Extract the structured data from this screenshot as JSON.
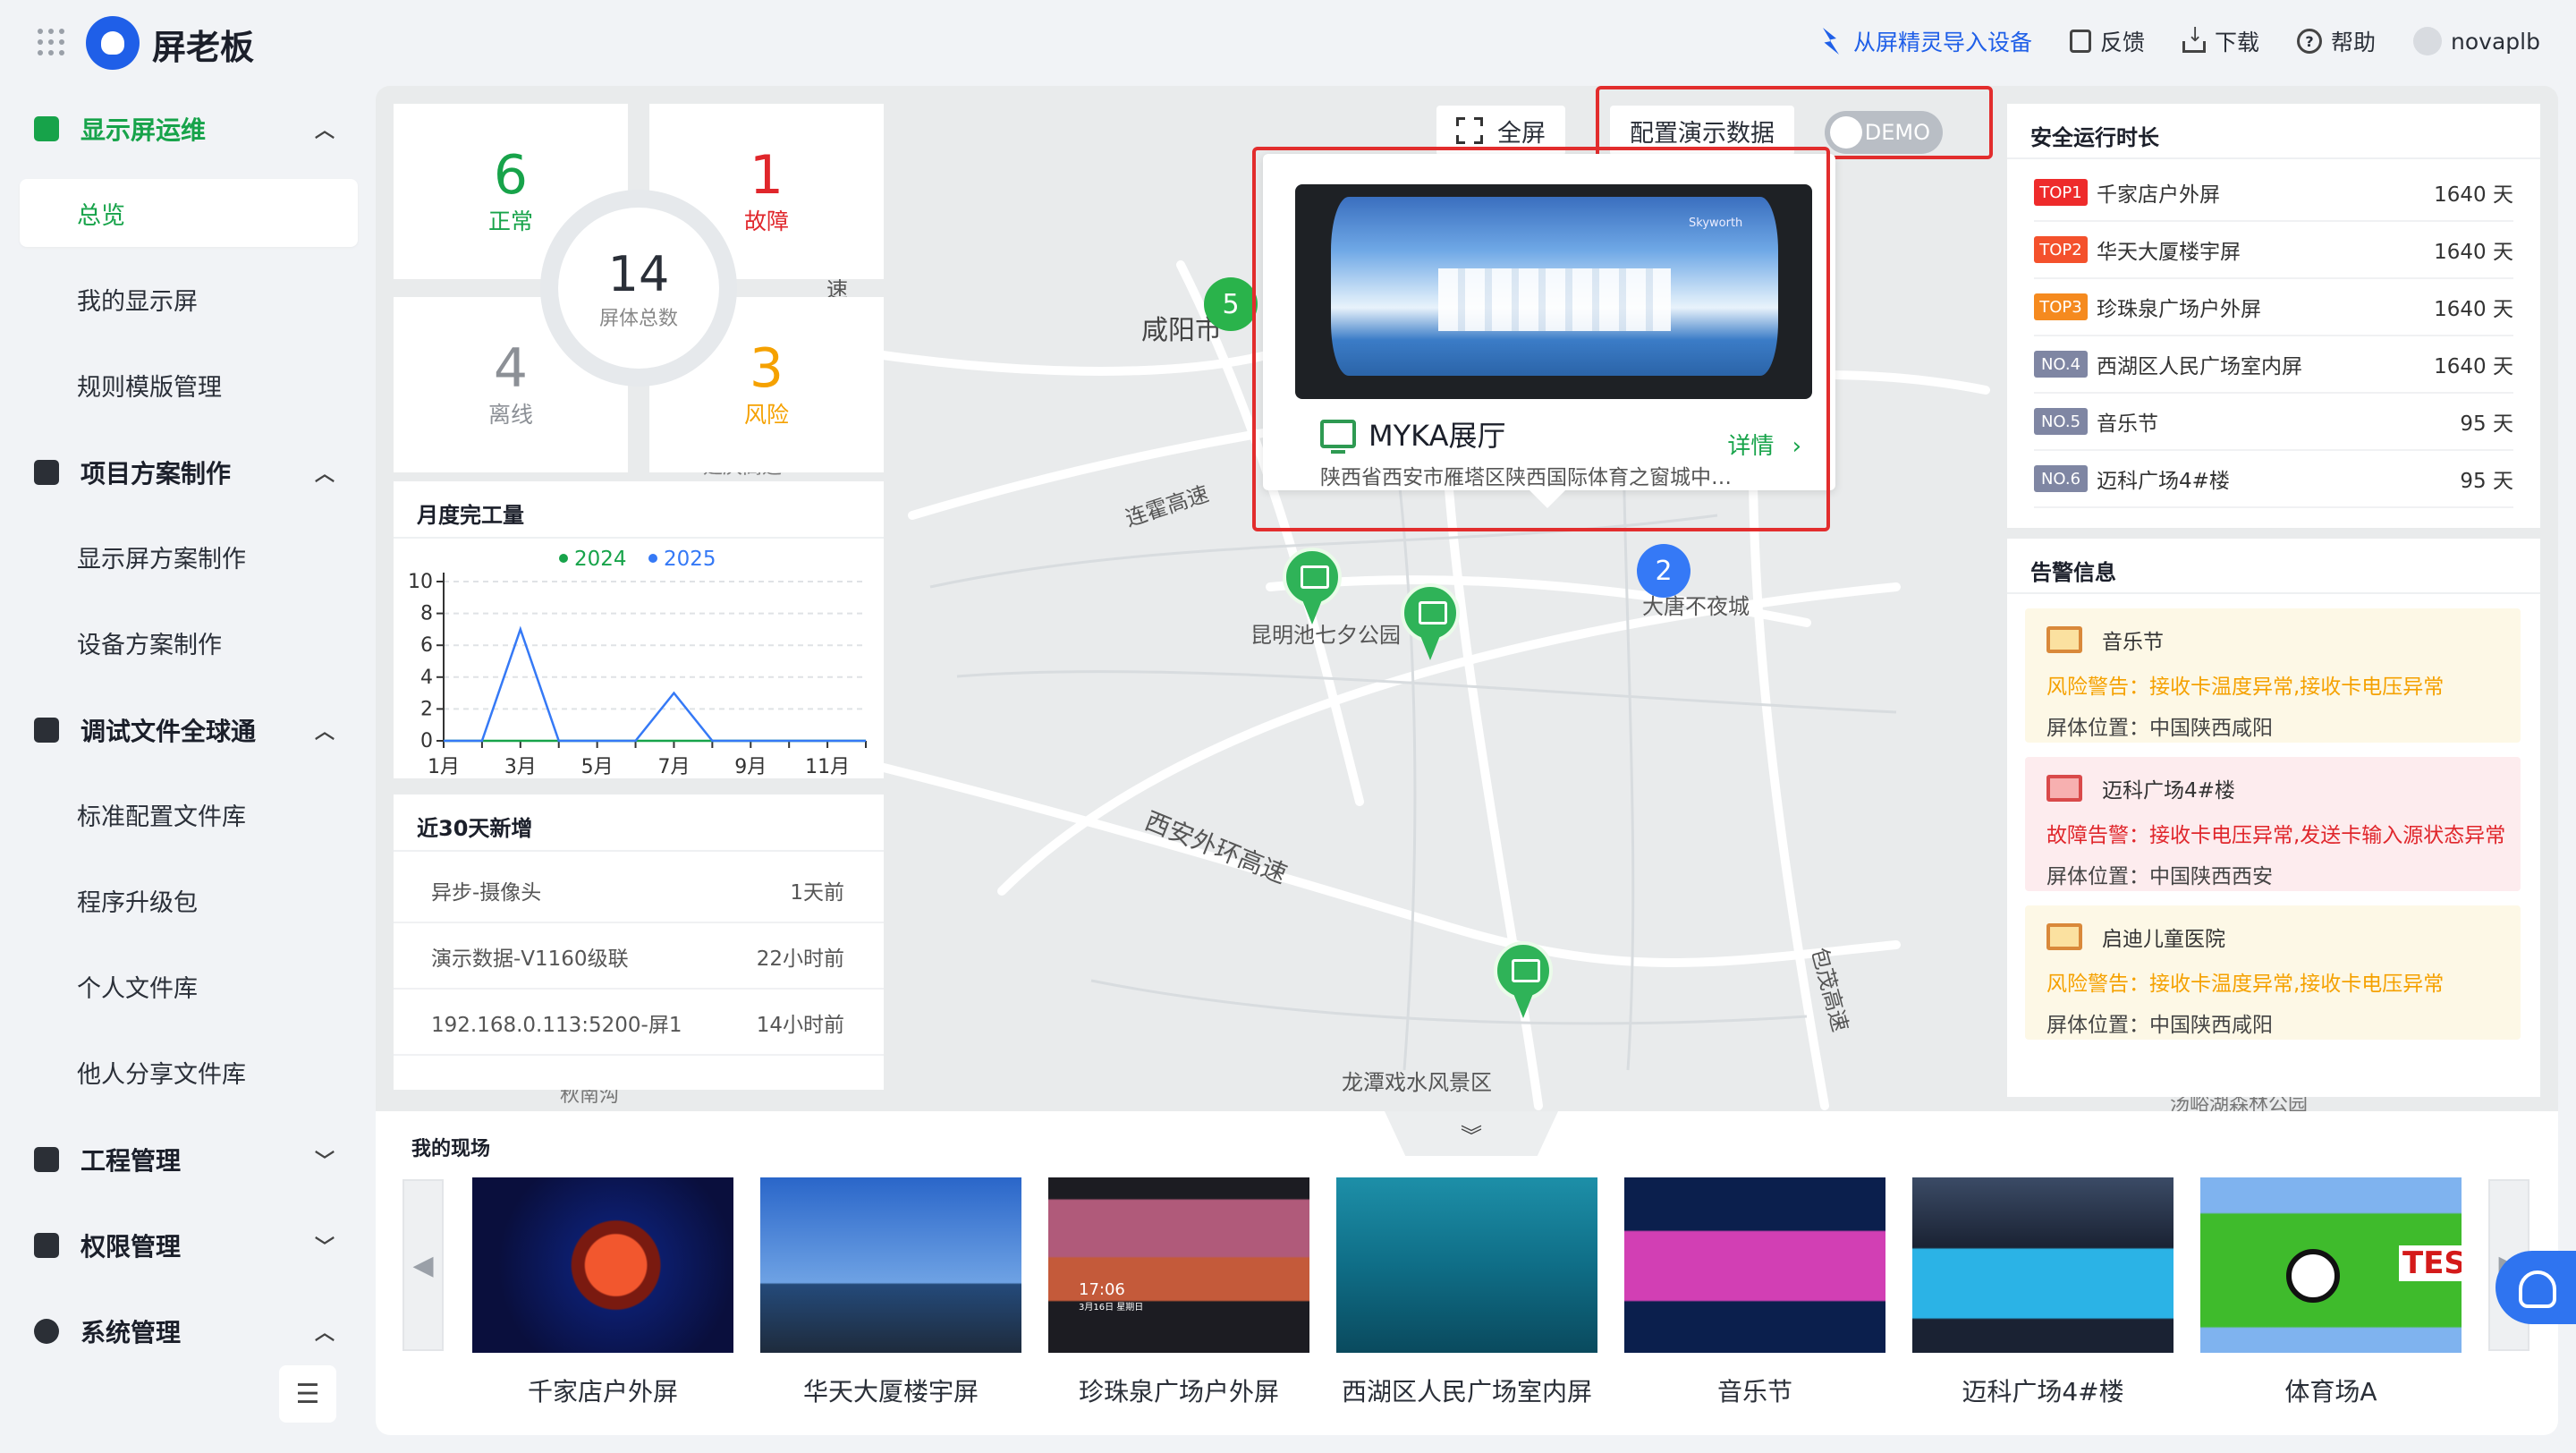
{
  "app": {
    "brand": "屏老板"
  },
  "topnav": {
    "import": "从屏精灵导入设备",
    "feedback": "反馈",
    "download": "下载",
    "help": "帮助",
    "user": "novaplb"
  },
  "sidebar": {
    "groups": [
      {
        "label": "显示屏运维",
        "icon": "monitor-chart-icon",
        "expanded": true
      },
      {
        "label": "项目方案制作",
        "icon": "folder-icon",
        "expanded": true
      },
      {
        "label": "调试文件全球通",
        "icon": "file-icon",
        "expanded": true
      },
      {
        "label": "工程管理",
        "icon": "grid-icon",
        "expanded": false
      },
      {
        "label": "权限管理",
        "icon": "permission-icon",
        "expanded": false
      },
      {
        "label": "系统管理",
        "icon": "settings-icon",
        "expanded": true
      }
    ],
    "items": [
      "总览",
      "我的显示屏",
      "规则模版管理",
      "显示屏方案制作",
      "设备方案制作",
      "标准配置文件库",
      "程序升级包",
      "个人文件库",
      "他人分享文件库"
    ]
  },
  "stats": {
    "normal": {
      "value": "6",
      "label": "正常",
      "color": "#17a34a"
    },
    "fault": {
      "value": "1",
      "label": "故障",
      "color": "#e0262b"
    },
    "offline": {
      "value": "4",
      "label": "离线",
      "color": "#8c9096"
    },
    "risk": {
      "value": "3",
      "label": "风险",
      "color": "#f5a100"
    },
    "total": {
      "value": "14",
      "label": "屏体总数"
    }
  },
  "monthly": {
    "title": "月度完工量",
    "chart_data": {
      "type": "line",
      "x": [
        "1月",
        "2月",
        "3月",
        "4月",
        "5月",
        "6月",
        "7月",
        "8月",
        "9月",
        "10月",
        "11月",
        "12月"
      ],
      "xticks": [
        "1月",
        "3月",
        "5月",
        "7月",
        "9月",
        "11月"
      ],
      "ylim": [
        0,
        10
      ],
      "yticks": [
        "0",
        "2",
        "4",
        "6",
        "8",
        "10"
      ],
      "series": [
        {
          "name": "2024",
          "color": "#17a34a",
          "values": [
            0,
            0,
            0,
            0,
            0,
            0,
            0,
            0,
            0,
            0,
            0,
            0
          ]
        },
        {
          "name": "2025",
          "color": "#3579f6",
          "values": [
            0,
            0,
            7,
            0,
            0,
            0,
            3,
            0,
            0,
            0,
            0,
            0
          ]
        }
      ],
      "legend": "top-center"
    }
  },
  "recent": {
    "title": "近30天新增",
    "rows": [
      {
        "name": "异步-摄像头",
        "time": "1天前"
      },
      {
        "name": "演示数据-V1160级联",
        "time": "22小时前"
      },
      {
        "name": "192.168.0.113:5200-屏1",
        "time": "14小时前"
      }
    ]
  },
  "map": {
    "labels": [
      "咸阳市",
      "连霍高速",
      "昆明池七夕公园",
      "大唐不夜城",
      "西安外环高速",
      "包茂高速",
      "龙潭戏水风景区",
      "速",
      "延庆高速",
      "秋南沟",
      "汤峪湖森林公园"
    ],
    "clusters": [
      "5",
      "2"
    ]
  },
  "toolbar": {
    "fullscreen": "全屏",
    "demo_config": "配置演示数据",
    "demo_toggle": "DEMO"
  },
  "popup": {
    "title": "MYKA展厅",
    "address": "陕西省西安市雁塔区陕西国际体育之窗城中城…",
    "detail": "详情",
    "image_brand": "Skyworth"
  },
  "safety": {
    "title": "安全运行时长",
    "rows": [
      {
        "rank": "TOP1",
        "color": "#ee2b2b",
        "name": "千家店户外屏",
        "days": "1640 天"
      },
      {
        "rank": "TOP2",
        "color": "#f4512c",
        "name": "华天大厦楼宇屏",
        "days": "1640 天"
      },
      {
        "rank": "TOP3",
        "color": "#f58a1f",
        "name": "珍珠泉广场户外屏",
        "days": "1640 天"
      },
      {
        "rank": "NO.4",
        "color": "#7f86a3",
        "name": "西湖区人民广场室内屏",
        "days": "1640 天"
      },
      {
        "rank": "NO.5",
        "color": "#7f86a3",
        "name": "音乐节",
        "days": "95 天"
      },
      {
        "rank": "NO.6",
        "color": "#7f86a3",
        "name": "迈科广场4#楼",
        "days": "95 天"
      }
    ]
  },
  "alerts": {
    "title": "告警信息",
    "items": [
      {
        "name": "音乐节",
        "message": "风险警告：接收卡温度异常,接收卡电压异常",
        "location": "屏体位置：中国陕西咸阳",
        "bg": "#fdf8e6",
        "color": "#f5a100"
      },
      {
        "name": "迈科广场4#楼",
        "message": "故障告警：接收卡电压异常,发送卡输入源状态异常",
        "location": "屏体位置：中国陕西西安",
        "bg": "#fdecee",
        "color": "#e0262b"
      },
      {
        "name": "启迪儿童医院",
        "message": "风险警告：接收卡温度异常,接收卡电压异常",
        "location": "屏体位置：中国陕西咸阳",
        "bg": "#fdf8e6",
        "color": "#f5a100"
      }
    ]
  },
  "sites": {
    "title": "我的现场",
    "items": [
      "千家店户外屏",
      "华天大厦楼宇屏",
      "珍珠泉广场户外屏",
      "西湖区人民广场室内屏",
      "音乐节",
      "迈科广场4#楼",
      "体育场A"
    ],
    "thumb_text": [
      "17:06",
      "3月16日 星期日",
      "TES"
    ]
  }
}
